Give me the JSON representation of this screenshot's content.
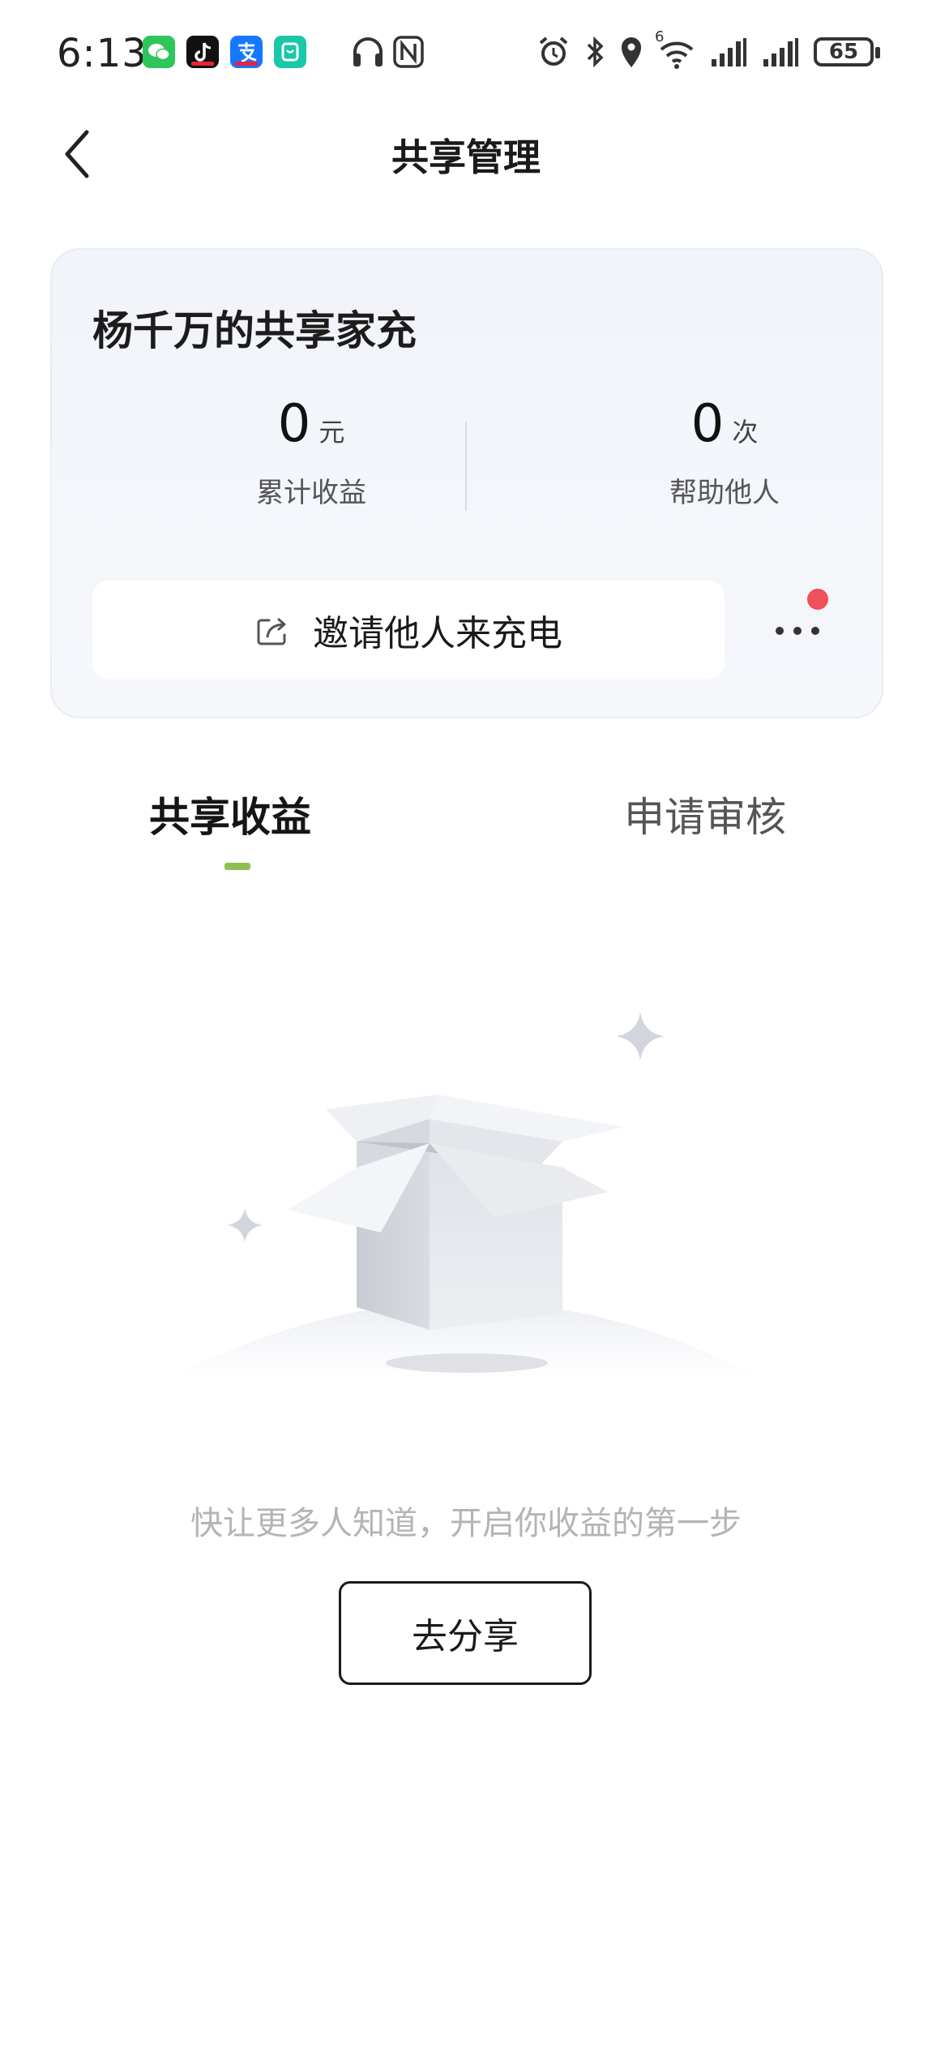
{
  "status_bar": {
    "time": "6:13",
    "battery": "65",
    "wifi_sub": "6",
    "app_icons": [
      "wechat-icon",
      "douyin-icon",
      "alipay-icon",
      "mi-home-icon"
    ],
    "system_icons": [
      "headphones-icon",
      "nfc-icon",
      "alarm-icon",
      "bluetooth-icon",
      "location-icon",
      "wifi-icon",
      "signal-icon",
      "signal-icon"
    ]
  },
  "header": {
    "title": "共享管理"
  },
  "card": {
    "title": "杨千万的共享家充",
    "earnings": {
      "value": "0",
      "unit": "元",
      "label": "累计收益"
    },
    "helped": {
      "value": "0",
      "unit": "次",
      "label": "帮助他人"
    },
    "invite_label": "邀请他人来充电"
  },
  "tabs": {
    "active": "共享收益",
    "inactive": "申请审核"
  },
  "empty_state": {
    "message": "快让更多人知道，开启你收益的第一步",
    "button_label": "去分享"
  },
  "colors": {
    "accent_green": "#8cc152",
    "notification_red": "#f0505a"
  }
}
